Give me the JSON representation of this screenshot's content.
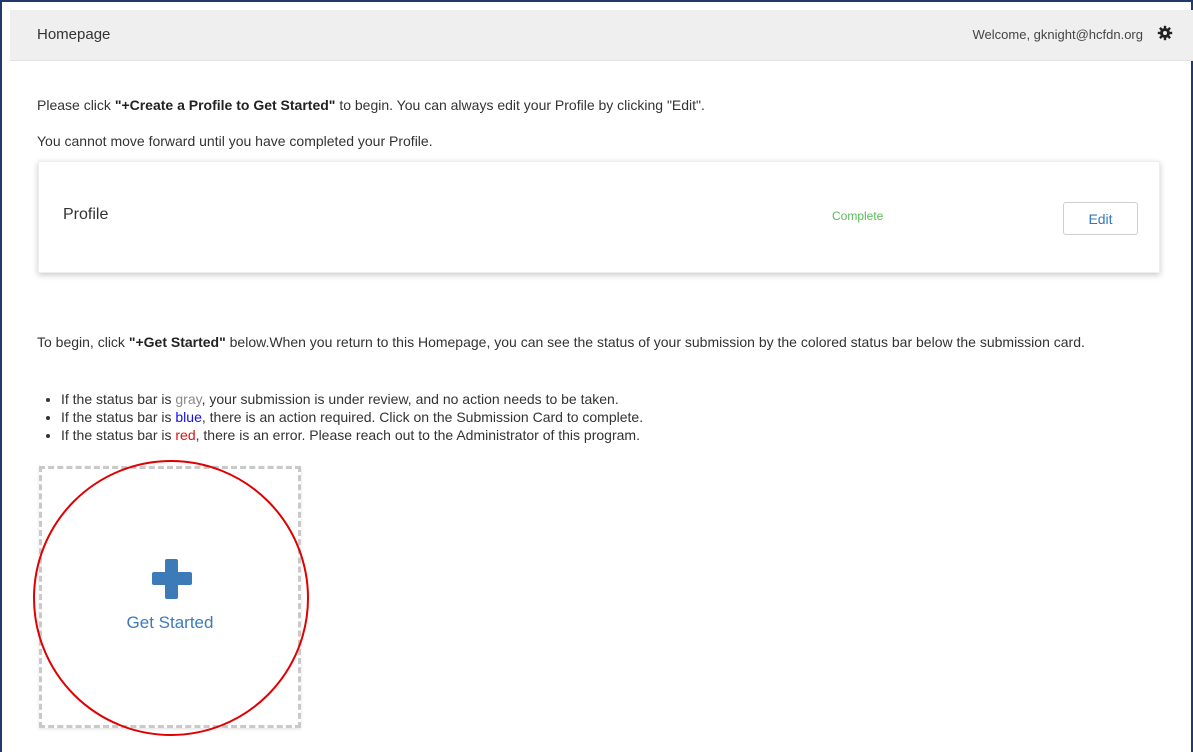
{
  "header": {
    "title": "Homepage",
    "welcome": "Welcome, gknight@hcfdn.org",
    "settings_icon": "gear-icon"
  },
  "intro": {
    "line1_prefix": "Please click ",
    "line1_bold": "\"+Create a Profile to Get Started\"",
    "line1_suffix": " to begin. You can always edit your Profile by clicking \"Edit\".",
    "line2": "You cannot move forward until you have completed your Profile."
  },
  "profile_card": {
    "label": "Profile",
    "status": "Complete",
    "edit_label": "Edit"
  },
  "instructions": {
    "prefix": "To begin, click ",
    "bold": "\"+Get Started\"",
    "suffix": " below.When you return to this Homepage, you can see the status of your submission by the colored status bar below the submission card.",
    "bullets": [
      {
        "pre": "If the status bar is ",
        "color_word": "gray",
        "post": ", your submission is under review, and no action needs to be taken."
      },
      {
        "pre": "If the status bar is ",
        "color_word": "blue",
        "post": ", there is an action required. Click on the Submission Card to complete."
      },
      {
        "pre": "If the status bar is ",
        "color_word": "red",
        "post": ", there is an error. Please reach out to the Administrator of this program."
      }
    ]
  },
  "get_started": {
    "label": "Get Started",
    "icon": "plus-icon"
  },
  "colors": {
    "accent": "#3d7ab8",
    "status_complete": "#5cb85c",
    "gray_word": "#8a8a8a",
    "blue_word": "#1010ee",
    "red_word": "#dd1111",
    "annotation_circle": "#e00000"
  }
}
